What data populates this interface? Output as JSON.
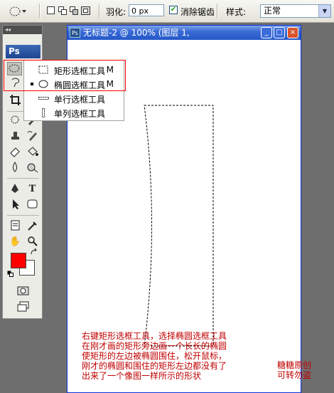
{
  "options_bar": {
    "feather_label": "羽化:",
    "feather_value": "0 px",
    "antialias_label": "消除锯齿",
    "antialias_checked": true,
    "style_label": "样式:",
    "style_value": "正常"
  },
  "toolbox": {
    "logo": "Ps",
    "collapse_glyph": "◂◂",
    "foreground_color": "#ff0000",
    "background_color": "#ffffff"
  },
  "document": {
    "icon": "Ps",
    "title": "无标题-2 @ 100% (图层 1,"
  },
  "context_menu": {
    "items": [
      {
        "label": "矩形选框工具",
        "shortcut": "M",
        "icon": "rect-marquee-icon",
        "selected": false
      },
      {
        "label": "椭圆选框工具",
        "shortcut": "M",
        "icon": "ellipse-marquee-icon",
        "selected": true
      },
      {
        "label": "单行选框工具",
        "shortcut": "",
        "icon": "single-row-marquee-icon",
        "selected": false
      },
      {
        "label": "单列选框工具",
        "shortcut": "",
        "icon": "single-column-marquee-icon",
        "selected": false
      }
    ]
  },
  "annotation": {
    "lines": [
      "右键矩形选框工具，选择椭圆选框工具",
      "在刚才画的矩形旁边画一个长长的椭圆",
      "使矩形的左边被椭圆围住，松开鼠标，",
      "刚才的椭圆和围住的矩形左边都没有了",
      "出来了一个像图一样所示的形状"
    ],
    "credit_lines": [
      "糖糖原创",
      "可转勿盗"
    ]
  },
  "colors": {
    "accent_red": "#c00000",
    "title_blue": "#2458c8"
  }
}
